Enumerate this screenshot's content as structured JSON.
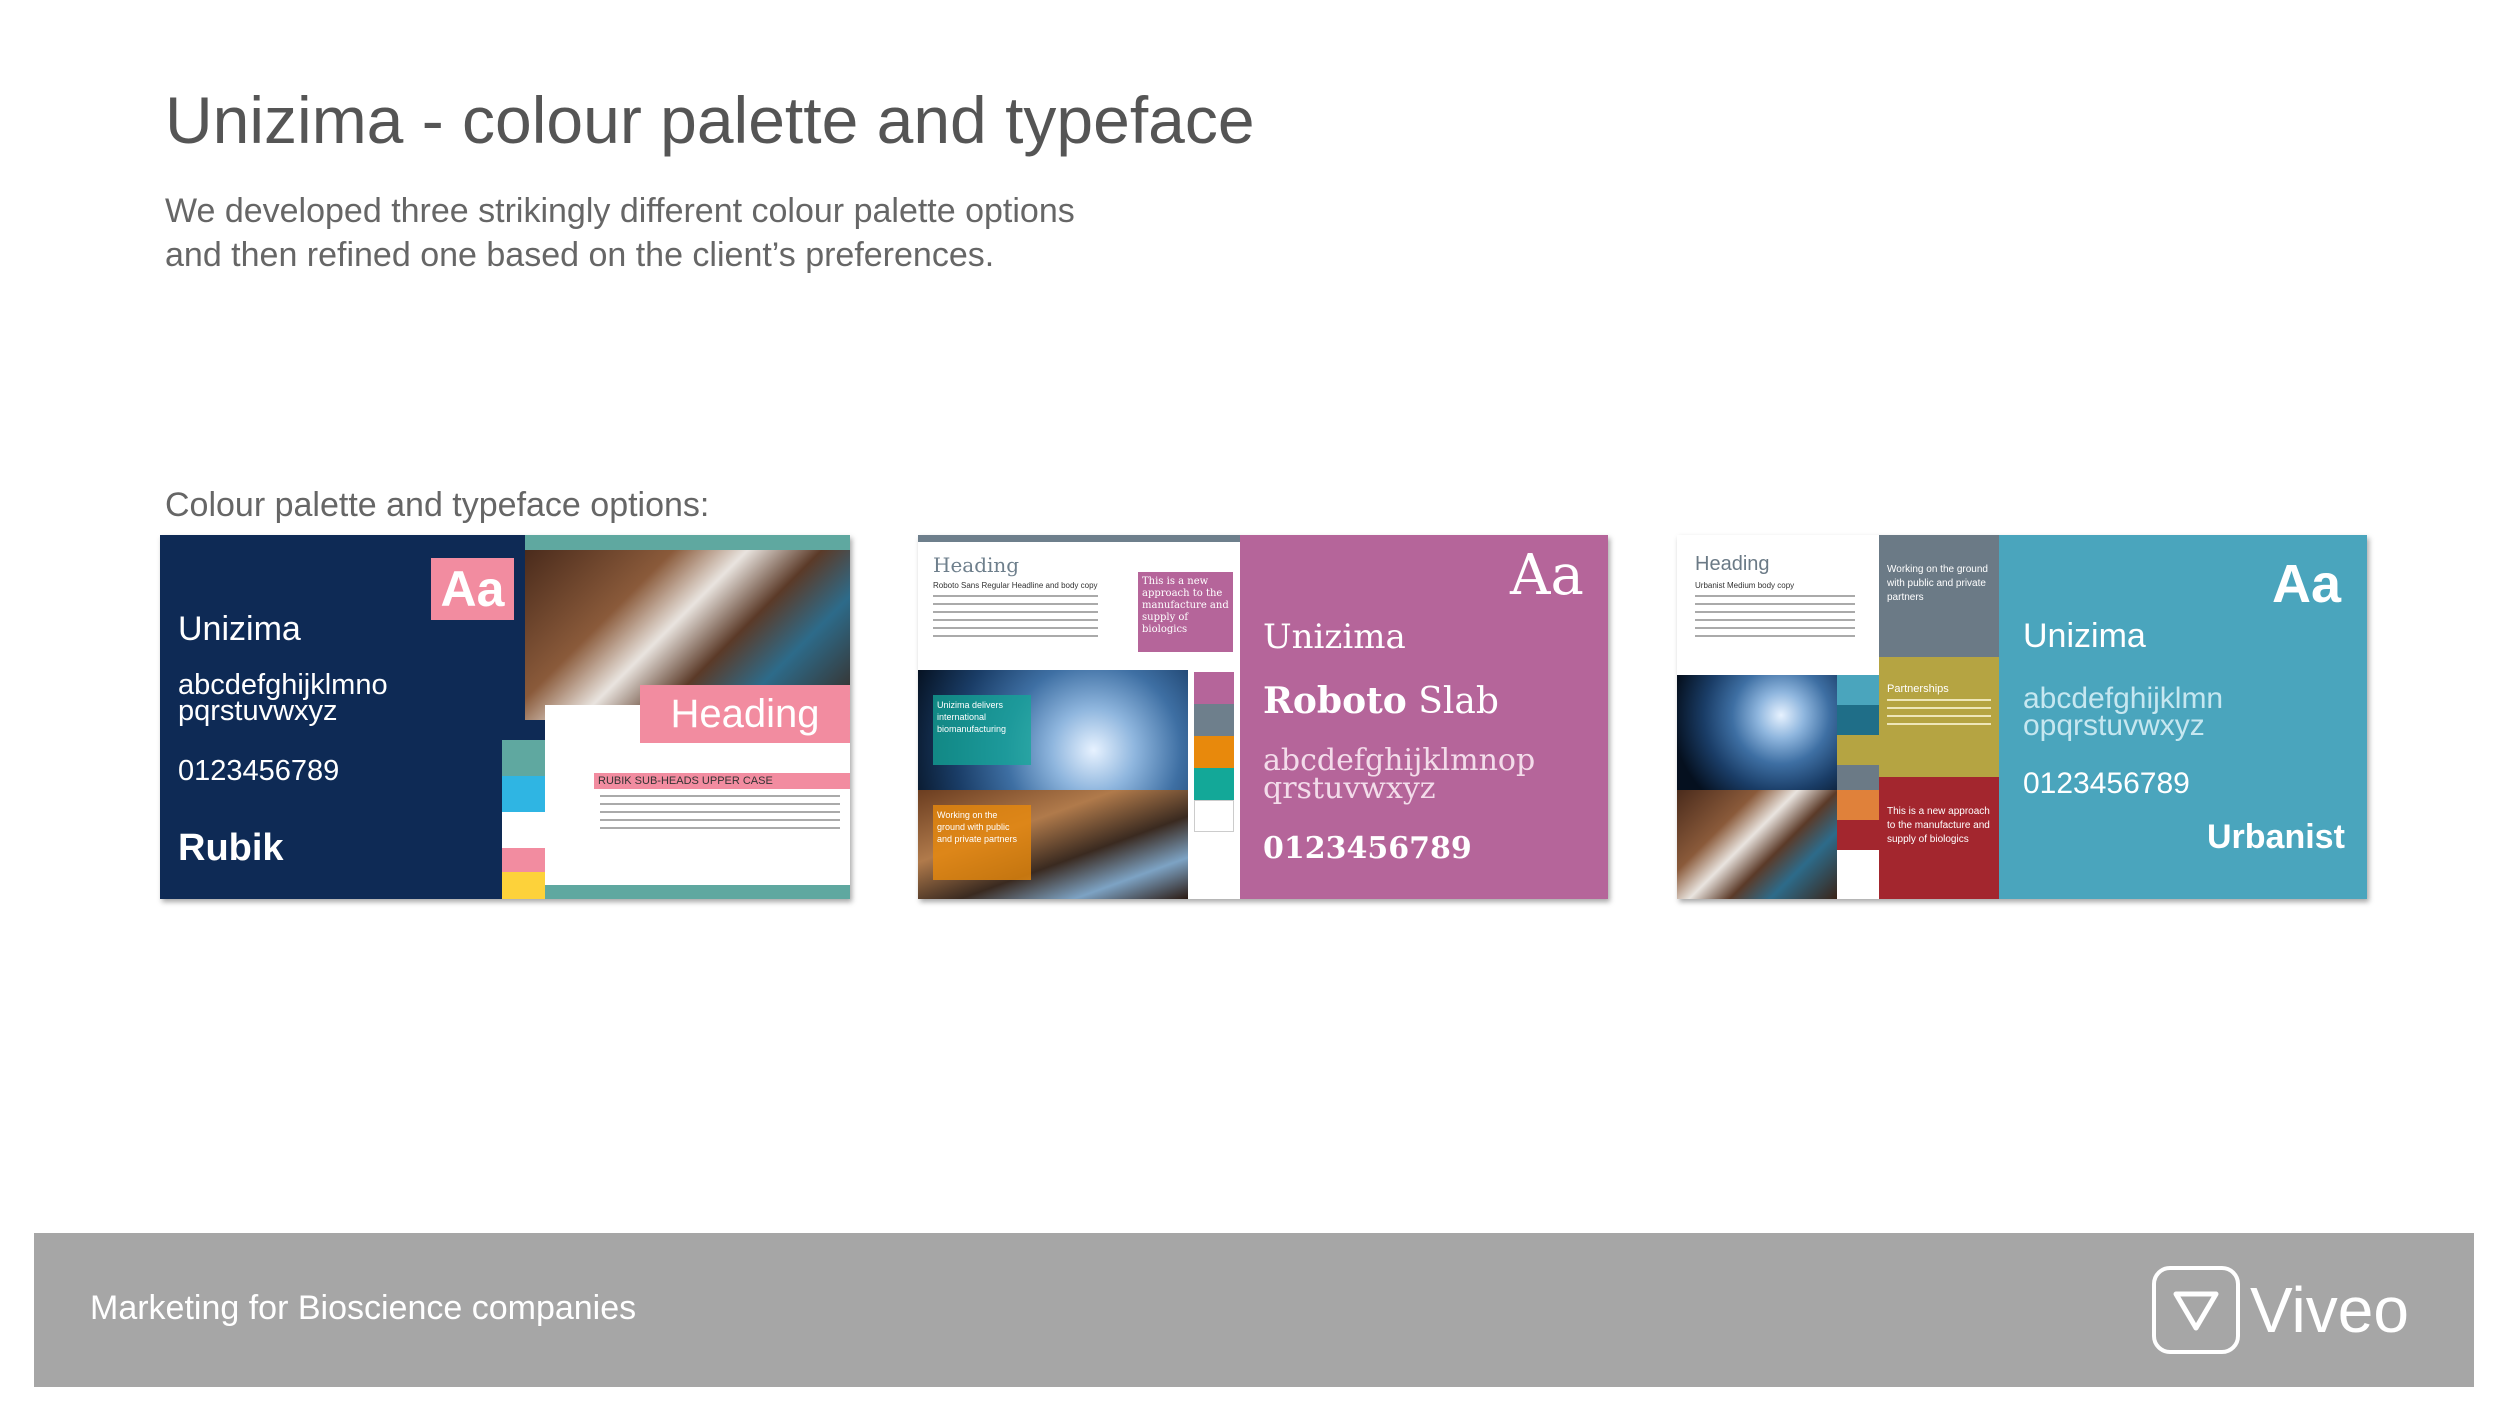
{
  "header": {
    "title": "Unizima - colour palette and typeface",
    "subtitle_line1": "We developed three strikingly different colour palette options",
    "subtitle_line2": "and then refined one based on the client’s preferences."
  },
  "options_label": "Colour palette and typeface options:",
  "option1": {
    "aa": "Aa",
    "brand": "Unizima",
    "alpha_line1": "abcdefghijklmno",
    "alpha_line2": "pqrstuvwxyz",
    "digits": "0123456789",
    "font_name": "Rubik",
    "heading": "Heading",
    "subheads": "RUBIK SUB-HEADS UPPER CASE",
    "colors": {
      "navy": "#0e2a55",
      "pink": "#f28ca0",
      "teal": "#5fa8a0",
      "blue": "#2fb5e3",
      "yellow": "#fdd23a"
    }
  },
  "option2": {
    "aa": "Aa",
    "brand": "Unizima",
    "font_bold": "Roboto",
    "font_light": "Slab",
    "alpha_line1": "abcdefghijklmnop",
    "alpha_line2": "qrstuvwxyz",
    "digits": "0123456789",
    "heading": "Heading",
    "body_title": "Roboto Sans Regular Headline and body copy",
    "callout": "This is a new approach to the manufacture and supply of biologics",
    "teal_box": "Unizima delivers international biomanufacturing",
    "orange_box": "Working on the ground with public and private partners",
    "colors": {
      "magenta": "#b5659a",
      "slate": "#6e7f8c",
      "orange": "#e8890c",
      "teal": "#13a898"
    }
  },
  "option3": {
    "aa": "Aa",
    "brand": "Unizima",
    "alpha_line1": "abcdefghijklmn",
    "alpha_line2": "opqrstuvwxyz",
    "digits": "0123456789",
    "font_name": "Urbanist",
    "heading": "Heading",
    "body_title": "Urbanist Medium body copy",
    "grey_box": "Working on the ground with public and private partners",
    "olive_title": "Partnerships",
    "red_box": "This is a new approach to the manufacture and supply of biologics",
    "colors": {
      "turquoise": "#4aa5bd",
      "grey": "#6b7a86",
      "olive": "#b5a442",
      "red": "#a3262e",
      "orange": "#e0813a"
    }
  },
  "footer": {
    "tagline": "Marketing for Bioscience companies",
    "logo_text": "Viveo"
  }
}
